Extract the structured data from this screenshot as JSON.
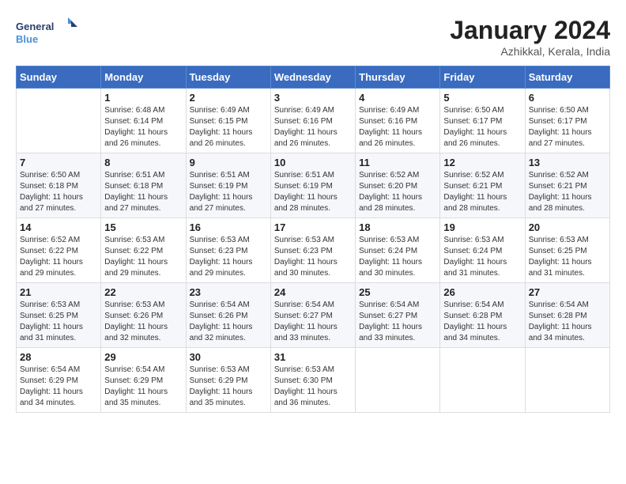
{
  "logo": {
    "line1": "General",
    "line2": "Blue"
  },
  "title": "January 2024",
  "location": "Azhikkal, Kerala, India",
  "days_of_week": [
    "Sunday",
    "Monday",
    "Tuesday",
    "Wednesday",
    "Thursday",
    "Friday",
    "Saturday"
  ],
  "weeks": [
    [
      {
        "day": "",
        "info": ""
      },
      {
        "day": "1",
        "info": "Sunrise: 6:48 AM\nSunset: 6:14 PM\nDaylight: 11 hours\nand 26 minutes."
      },
      {
        "day": "2",
        "info": "Sunrise: 6:49 AM\nSunset: 6:15 PM\nDaylight: 11 hours\nand 26 minutes."
      },
      {
        "day": "3",
        "info": "Sunrise: 6:49 AM\nSunset: 6:16 PM\nDaylight: 11 hours\nand 26 minutes."
      },
      {
        "day": "4",
        "info": "Sunrise: 6:49 AM\nSunset: 6:16 PM\nDaylight: 11 hours\nand 26 minutes."
      },
      {
        "day": "5",
        "info": "Sunrise: 6:50 AM\nSunset: 6:17 PM\nDaylight: 11 hours\nand 26 minutes."
      },
      {
        "day": "6",
        "info": "Sunrise: 6:50 AM\nSunset: 6:17 PM\nDaylight: 11 hours\nand 27 minutes."
      }
    ],
    [
      {
        "day": "7",
        "info": "Sunrise: 6:50 AM\nSunset: 6:18 PM\nDaylight: 11 hours\nand 27 minutes."
      },
      {
        "day": "8",
        "info": "Sunrise: 6:51 AM\nSunset: 6:18 PM\nDaylight: 11 hours\nand 27 minutes."
      },
      {
        "day": "9",
        "info": "Sunrise: 6:51 AM\nSunset: 6:19 PM\nDaylight: 11 hours\nand 27 minutes."
      },
      {
        "day": "10",
        "info": "Sunrise: 6:51 AM\nSunset: 6:19 PM\nDaylight: 11 hours\nand 28 minutes."
      },
      {
        "day": "11",
        "info": "Sunrise: 6:52 AM\nSunset: 6:20 PM\nDaylight: 11 hours\nand 28 minutes."
      },
      {
        "day": "12",
        "info": "Sunrise: 6:52 AM\nSunset: 6:21 PM\nDaylight: 11 hours\nand 28 minutes."
      },
      {
        "day": "13",
        "info": "Sunrise: 6:52 AM\nSunset: 6:21 PM\nDaylight: 11 hours\nand 28 minutes."
      }
    ],
    [
      {
        "day": "14",
        "info": "Sunrise: 6:52 AM\nSunset: 6:22 PM\nDaylight: 11 hours\nand 29 minutes."
      },
      {
        "day": "15",
        "info": "Sunrise: 6:53 AM\nSunset: 6:22 PM\nDaylight: 11 hours\nand 29 minutes."
      },
      {
        "day": "16",
        "info": "Sunrise: 6:53 AM\nSunset: 6:23 PM\nDaylight: 11 hours\nand 29 minutes."
      },
      {
        "day": "17",
        "info": "Sunrise: 6:53 AM\nSunset: 6:23 PM\nDaylight: 11 hours\nand 30 minutes."
      },
      {
        "day": "18",
        "info": "Sunrise: 6:53 AM\nSunset: 6:24 PM\nDaylight: 11 hours\nand 30 minutes."
      },
      {
        "day": "19",
        "info": "Sunrise: 6:53 AM\nSunset: 6:24 PM\nDaylight: 11 hours\nand 31 minutes."
      },
      {
        "day": "20",
        "info": "Sunrise: 6:53 AM\nSunset: 6:25 PM\nDaylight: 11 hours\nand 31 minutes."
      }
    ],
    [
      {
        "day": "21",
        "info": "Sunrise: 6:53 AM\nSunset: 6:25 PM\nDaylight: 11 hours\nand 31 minutes."
      },
      {
        "day": "22",
        "info": "Sunrise: 6:53 AM\nSunset: 6:26 PM\nDaylight: 11 hours\nand 32 minutes."
      },
      {
        "day": "23",
        "info": "Sunrise: 6:54 AM\nSunset: 6:26 PM\nDaylight: 11 hours\nand 32 minutes."
      },
      {
        "day": "24",
        "info": "Sunrise: 6:54 AM\nSunset: 6:27 PM\nDaylight: 11 hours\nand 33 minutes."
      },
      {
        "day": "25",
        "info": "Sunrise: 6:54 AM\nSunset: 6:27 PM\nDaylight: 11 hours\nand 33 minutes."
      },
      {
        "day": "26",
        "info": "Sunrise: 6:54 AM\nSunset: 6:28 PM\nDaylight: 11 hours\nand 34 minutes."
      },
      {
        "day": "27",
        "info": "Sunrise: 6:54 AM\nSunset: 6:28 PM\nDaylight: 11 hours\nand 34 minutes."
      }
    ],
    [
      {
        "day": "28",
        "info": "Sunrise: 6:54 AM\nSunset: 6:29 PM\nDaylight: 11 hours\nand 34 minutes."
      },
      {
        "day": "29",
        "info": "Sunrise: 6:54 AM\nSunset: 6:29 PM\nDaylight: 11 hours\nand 35 minutes."
      },
      {
        "day": "30",
        "info": "Sunrise: 6:53 AM\nSunset: 6:29 PM\nDaylight: 11 hours\nand 35 minutes."
      },
      {
        "day": "31",
        "info": "Sunrise: 6:53 AM\nSunset: 6:30 PM\nDaylight: 11 hours\nand 36 minutes."
      },
      {
        "day": "",
        "info": ""
      },
      {
        "day": "",
        "info": ""
      },
      {
        "day": "",
        "info": ""
      }
    ]
  ]
}
